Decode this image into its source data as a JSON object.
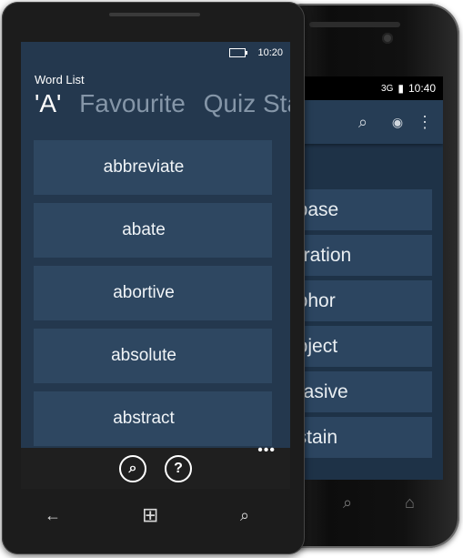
{
  "windows_phone": {
    "status": {
      "time": "10:20"
    },
    "app_title": "Word List",
    "pivot": [
      {
        "label": "'A'",
        "active": true
      },
      {
        "label": "Favourite",
        "active": false
      },
      {
        "label": "Quiz Sta",
        "active": false
      }
    ],
    "words": [
      "abbreviate",
      "abate",
      "abortive",
      "absolute",
      "abstract"
    ],
    "appbar": {
      "search_glyph": "⌕",
      "help_glyph": "?",
      "more_glyph": "•••"
    },
    "navbar": {
      "back_glyph": "←",
      "windows_glyph": "⊞",
      "search_glyph": "⌕"
    }
  },
  "android_phone": {
    "status": {
      "signal": "3G",
      "time": "10:40"
    },
    "actionbar": {
      "search_glyph": "⌕",
      "eye_glyph": "◉",
      "overflow_glyph": "⋮"
    },
    "words": [
      "abase",
      "erration",
      "abhor",
      "abject",
      "brasive",
      "ostain"
    ],
    "navbar": {
      "search_glyph": "⌕",
      "home_glyph": "⌂"
    }
  },
  "colors": {
    "wp_screen": "#24384e",
    "wp_item": "#2e4761",
    "android_screen": "#1e3247",
    "android_item": "#2c4560"
  }
}
